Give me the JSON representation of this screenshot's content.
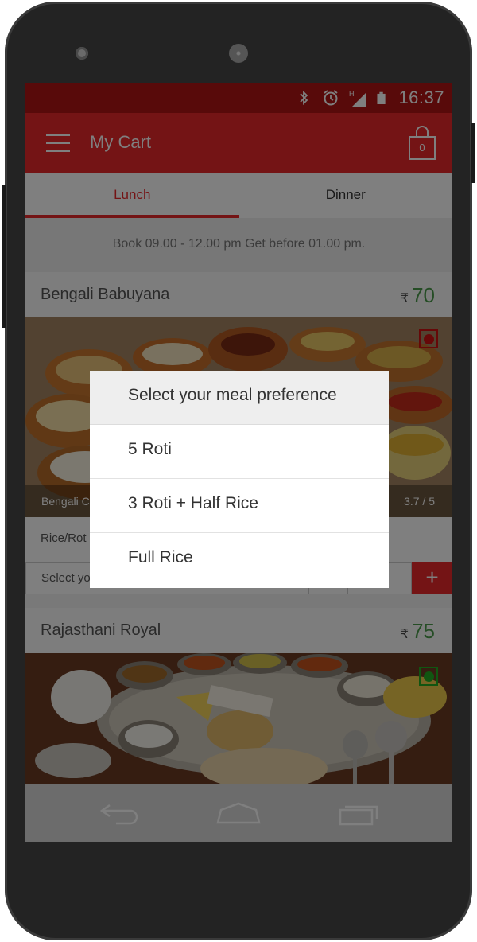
{
  "status_bar": {
    "time": "16:37",
    "icons": [
      "bluetooth-icon",
      "alarm-icon",
      "signal-icon",
      "battery-icon"
    ],
    "color": "#b01414"
  },
  "app_bar": {
    "title": "My Cart",
    "cart_count": "0",
    "color": "#e8282b"
  },
  "tabs": [
    {
      "label": "Lunch",
      "active": true
    },
    {
      "label": "Dinner",
      "active": false
    }
  ],
  "booking_note": "Book 09.00 - 12.00 pm Get before 01.00 pm.",
  "meals": [
    {
      "name": "Bengali Babuyana",
      "currency": "₹",
      "price": "70",
      "caption": "Bengali Co",
      "rating": "3.7 / 5",
      "diet": "non-veg",
      "diet_color": "#cc1111"
    },
    {
      "name": "Rajasthani Royal",
      "currency": "₹",
      "price": "75",
      "diet": "veg",
      "diet_color": "#22aa22"
    }
  ],
  "preference_row": {
    "label": "Rice/Rot",
    "select_placeholder": "Select yo",
    "add_label": "+"
  },
  "dialog": {
    "title": "Select your meal preference",
    "options": [
      "5 Roti",
      "3 Roti + Half Rice",
      "Full Rice"
    ]
  },
  "nav_bar": {
    "buttons": [
      "back-icon",
      "home-icon",
      "recents-icon"
    ]
  }
}
